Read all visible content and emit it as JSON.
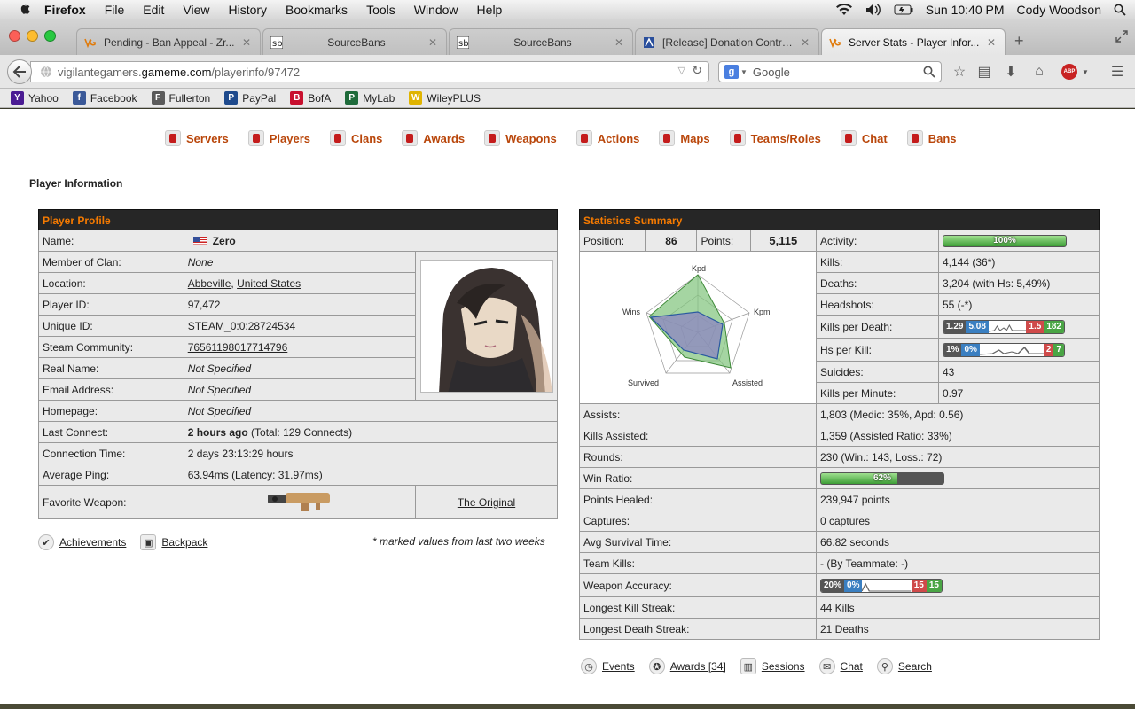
{
  "menubar": {
    "app": "Firefox",
    "items": [
      "File",
      "Edit",
      "View",
      "History",
      "Bookmarks",
      "Tools",
      "Window",
      "Help"
    ],
    "clock": "Sun 10:40 PM",
    "user": "Cody Woodson"
  },
  "tabs": [
    {
      "label": "Pending - Ban Appeal - Zr..."
    },
    {
      "label": "SourceBans"
    },
    {
      "label": "SourceBans"
    },
    {
      "label": "[Release] Donation Contro..."
    },
    {
      "label": "Server Stats - Player Infor..."
    }
  ],
  "navbar": {
    "url_prefix": "vigilantegamers.",
    "url_host": "gameme.com",
    "url_path": "/playerinfo/97472",
    "search_placeholder": "Google"
  },
  "bookmarks": [
    {
      "label": "Yahoo",
      "icon": "Y",
      "color": "#4b1c93"
    },
    {
      "label": "Facebook",
      "icon": "f",
      "color": "#3b5998"
    },
    {
      "label": "Fullerton",
      "icon": "F",
      "color": "#5a5a5a"
    },
    {
      "label": "PayPal",
      "icon": "P",
      "color": "#1e4a8c"
    },
    {
      "label": "BofA",
      "icon": "B",
      "color": "#c8102e"
    },
    {
      "label": "MyLab",
      "icon": "P",
      "color": "#1f6b3a"
    },
    {
      "label": "WileyPLUS",
      "icon": "W",
      "color": "#e0b400"
    }
  ],
  "topnav": [
    "Servers",
    "Players",
    "Clans",
    "Awards",
    "Weapons",
    "Actions",
    "Maps",
    "Teams/Roles",
    "Chat",
    "Bans"
  ],
  "page_title": "Player Information",
  "profile": {
    "header": "Player Profile",
    "rows": {
      "name_k": "Name:",
      "name_v": "Zero",
      "clan_k": "Member of Clan:",
      "clan_v": "None",
      "loc_k": "Location:",
      "loc_city": "Abbeville",
      "loc_country": "United States",
      "pid_k": "Player ID:",
      "pid_v": "97,472",
      "uid_k": "Unique ID:",
      "uid_v": "STEAM_0:0:28724534",
      "steam_k": "Steam Community:",
      "steam_v": "76561198017714796",
      "real_k": "Real Name:",
      "real_v": "Not Specified",
      "email_k": "Email Address:",
      "email_v": "Not Specified",
      "home_k": "Homepage:",
      "home_v": "Not Specified",
      "last_k": "Last Connect:",
      "last_v_bold": "2 hours ago",
      "last_v_rest": " (Total: 129 Connects)",
      "conn_k": "Connection Time:",
      "conn_v": "2 days 23:13:29 hours",
      "ping_k": "Average Ping:",
      "ping_v": "63.94ms (Latency: 31.97ms)",
      "weap_k": "Favorite Weapon:",
      "weap_name": "The Original"
    }
  },
  "profile_links": {
    "achievements": "Achievements",
    "backpack": "Backpack"
  },
  "note": "* marked values from last two weeks",
  "stats": {
    "header": "Statistics Summary",
    "position_k": "Position:",
    "position_v": "86",
    "points_k": "Points:",
    "points_v": "5,115",
    "activity_k": "Activity:",
    "activity_v": "100%",
    "activity_fraction": 1.0,
    "radar_labels": {
      "kpd": "Kpd",
      "kpm": "Kpm",
      "assisted": "Assisted",
      "survived": "Survived",
      "wins": "Wins"
    },
    "kills_k": "Kills:",
    "kills_v": "4,144 (36*)",
    "deaths_k": "Deaths:",
    "deaths_v": "3,204 (with Hs: 5,49%)",
    "hs_k": "Headshots:",
    "hs_v": "55 (-*)",
    "kpd_k": "Kills per Death:",
    "kpd_a": "1.29",
    "kpd_b": "5.08",
    "kpd_c": "1.5",
    "kpd_d": "182",
    "hpk_k": "Hs per Kill:",
    "hpk_a": "1%",
    "hpk_b": "0%",
    "hpk_c": "2",
    "hpk_d": "7",
    "sui_k": "Suicides:",
    "sui_v": "43",
    "kpm_k": "Kills per Minute:",
    "kpm_v": "0.97",
    "assists_k": "Assists:",
    "assists_v": "1,803 (Medic: 35%, Apd: 0.56)",
    "ka_k": "Kills Assisted:",
    "ka_v": "1,359 (Assisted Ratio: 33%)",
    "rounds_k": "Rounds:",
    "rounds_v": "230 (Win.: 143, Loss.: 72)",
    "wr_k": "Win Ratio:",
    "wr_v": "62%",
    "wr_fraction": 0.62,
    "ph_k": "Points Healed:",
    "ph_v": "239,947 points",
    "cap_k": "Captures:",
    "cap_v": "0 captures",
    "ast_k": "Avg Survival Time:",
    "ast_v": "66.82 seconds",
    "tk_k": "Team Kills:",
    "tk_v": "- (By Teammate: -)",
    "wa_k": "Weapon Accuracy:",
    "wa_a": "20%",
    "wa_b": "0%",
    "wa_c": "15",
    "wa_d": "15",
    "lks_k": "Longest Kill Streak:",
    "lks_v": "44 Kills",
    "lds_k": "Longest Death Streak:",
    "lds_v": "21 Deaths"
  },
  "stats_links": {
    "events": "Events",
    "awards": "Awards [34]",
    "sessions": "Sessions",
    "chat": "Chat",
    "search": "Search"
  }
}
